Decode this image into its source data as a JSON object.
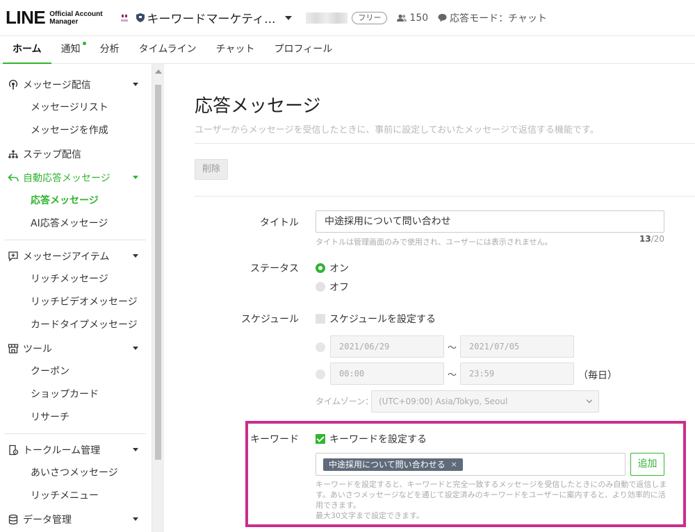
{
  "header": {
    "logo_main": "LINE",
    "logo_sub_1": "Official Account",
    "logo_sub_2": "Manager",
    "account_name": "キーワードマーケティ...",
    "plan": "フリー",
    "friends_count": "150",
    "mode": "応答モード：チャット",
    "icons": [
      "account-thumbnail",
      "shield-icon",
      "chevron-down-icon",
      "user-group-icon",
      "chat-bubble-icon"
    ]
  },
  "tabs": [
    {
      "label": "ホーム",
      "active": true
    },
    {
      "label": "通知",
      "has_dot": true
    },
    {
      "label": "分析"
    },
    {
      "label": "タイムライン"
    },
    {
      "label": "チャット"
    },
    {
      "label": "プロフィール"
    }
  ],
  "sidebar": {
    "groups": [
      {
        "label": "メッセージ配信",
        "icon": "broadcast-icon",
        "items": [
          "メッセージリスト",
          "メッセージを作成"
        ]
      },
      {
        "label": "ステップ配信",
        "icon": "step-tree-icon",
        "items": []
      },
      {
        "label": "自動応答メッセージ",
        "icon": "reply-icon",
        "active": true,
        "items": [
          "応答メッセージ",
          "AI応答メッセージ"
        ],
        "active_item": "応答メッセージ"
      },
      {
        "label": "メッセージアイテム",
        "icon": "message-plus-icon",
        "items": [
          "リッチメッセージ",
          "リッチビデオメッセージ",
          "カードタイプメッセージ"
        ]
      },
      {
        "label": "ツール",
        "icon": "shop-icon",
        "items": [
          "クーポン",
          "ショップカード",
          "リサーチ"
        ]
      },
      {
        "label": "トークルーム管理",
        "icon": "chat-settings-icon",
        "items": [
          "あいさつメッセージ",
          "リッチメニュー"
        ]
      },
      {
        "label": "データ管理",
        "icon": "database-icon",
        "items": []
      }
    ]
  },
  "main": {
    "title": "応答メッセージ",
    "description": "ユーザーからメッセージを受信したときに、事前に設定しておいたメッセージで返信する機能です。",
    "delete_label": "削除",
    "form": {
      "title_label": "タイトル",
      "title_value": "中途採用について問い合わせ",
      "title_hint": "タイトルは管理画面のみで使用され、ユーザーには表示されません。",
      "title_count": "13",
      "title_max": "/20",
      "status_label": "ステータス",
      "status_on": "オン",
      "status_off": "オフ",
      "status_selected": "オン",
      "schedule_label": "スケジュール",
      "schedule_checkbox": "スケジュールを設定する",
      "schedule_checked": false,
      "date_start": "2021/06/29",
      "date_end": "2021/07/05",
      "time_start": "00:00",
      "time_end": "23:59",
      "tilde": "～",
      "daily": "（毎日）",
      "timezone_label": "タイムゾーン：",
      "timezone_value": "(UTC+09:00) Asia/Tokyo, Seoul",
      "keyword_label": "キーワード",
      "keyword_checkbox": "キーワードを設定する",
      "keyword_checked": true,
      "keyword_tag": "中途採用について問い合わせる",
      "keyword_tag_remove": "×",
      "add_label": "追加",
      "keyword_hint": "キーワードを設定すると、キーワードと完全一致するメッセージを受信したときにのみ自動で返信します。あいさつメッセージなどを通じて設定済みのキーワードをユーザーに案内すると、より効率的に活用できます。",
      "keyword_limit": "最大30文字まで設定できます。"
    },
    "highlight_color": "#cc2d8b",
    "accent_color": "#2fb52f"
  }
}
